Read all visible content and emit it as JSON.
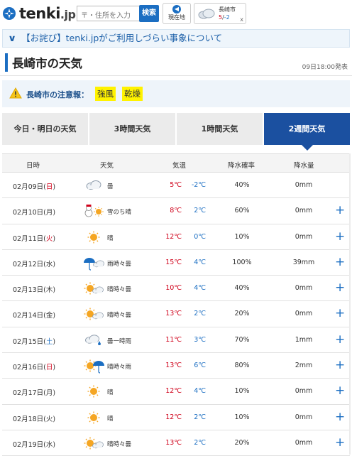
{
  "header": {
    "logo": "tenki",
    "logo_suffix": ".jp",
    "search_placeholder": "〒・住所を入力",
    "search_button": "検索",
    "geo_button": "現在地",
    "fav_city": "長崎市",
    "fav_temp": "5/-2",
    "fav_close": "x"
  },
  "notice": {
    "text": "【お詫び】tenki.jpがご利用しづらい事象について"
  },
  "page": {
    "title": "長崎市の天気",
    "published": "09日18:00発表"
  },
  "warning": {
    "label": "長崎市の注意報：",
    "tags": [
      "強風",
      "乾燥"
    ]
  },
  "tabs": [
    {
      "label": "今日・明日の天気",
      "active": false
    },
    {
      "label": "3時間天気",
      "active": false
    },
    {
      "label": "1時間天気",
      "active": false
    },
    {
      "label": "2週間天気",
      "active": true
    }
  ],
  "table": {
    "headers": [
      "日時",
      "天気",
      "気温",
      "降水確率",
      "降水量"
    ],
    "rows": [
      {
        "date": "02月09日(",
        "dow": "日",
        "dowType": "sun",
        "icon": "cloudy",
        "weather": "曇",
        "hi": "5℃",
        "lo": "-2℃",
        "pop": "40%",
        "amt": "0mm",
        "plus": ""
      },
      {
        "date": "02月10日(",
        "dow": "月",
        "dowType": "",
        "icon": "snow-then-sunny",
        "weather": "雪のち晴",
        "hi": "8℃",
        "lo": "2℃",
        "pop": "60%",
        "amt": "0mm",
        "plus": "+"
      },
      {
        "date": "02月11日(",
        "dow": "火",
        "dowType": "sun",
        "icon": "sunny",
        "weather": "晴",
        "hi": "12℃",
        "lo": "0℃",
        "pop": "10%",
        "amt": "0mm",
        "plus": "+"
      },
      {
        "date": "02月12日(",
        "dow": "水",
        "dowType": "",
        "icon": "rain-sometimes-cloudy",
        "weather": "雨時々曇",
        "hi": "15℃",
        "lo": "4℃",
        "pop": "100%",
        "amt": "39mm",
        "plus": "+"
      },
      {
        "date": "02月13日(",
        "dow": "木",
        "dowType": "",
        "icon": "sunny-sometimes-cloudy",
        "weather": "晴時々曇",
        "hi": "10℃",
        "lo": "4℃",
        "pop": "40%",
        "amt": "0mm",
        "plus": "+"
      },
      {
        "date": "02月14日(",
        "dow": "金",
        "dowType": "",
        "icon": "sunny-sometimes-cloudy",
        "weather": "晴時々曇",
        "hi": "13℃",
        "lo": "2℃",
        "pop": "20%",
        "amt": "0mm",
        "plus": "+"
      },
      {
        "date": "02月15日(",
        "dow": "土",
        "dowType": "sat",
        "icon": "cloudy-briefly-rain",
        "weather": "曇一時雨",
        "hi": "11℃",
        "lo": "3℃",
        "pop": "70%",
        "amt": "1mm",
        "plus": "+"
      },
      {
        "date": "02月16日(",
        "dow": "日",
        "dowType": "sun",
        "icon": "sunny-sometimes-rain",
        "weather": "晴時々雨",
        "hi": "13℃",
        "lo": "6℃",
        "pop": "80%",
        "amt": "2mm",
        "plus": "+"
      },
      {
        "date": "02月17日(",
        "dow": "月",
        "dowType": "",
        "icon": "sunny",
        "weather": "晴",
        "hi": "12℃",
        "lo": "4℃",
        "pop": "10%",
        "amt": "0mm",
        "plus": "+"
      },
      {
        "date": "02月18日(",
        "dow": "火",
        "dowType": "",
        "icon": "sunny",
        "weather": "晴",
        "hi": "12℃",
        "lo": "2℃",
        "pop": "10%",
        "amt": "0mm",
        "plus": "+"
      },
      {
        "date": "02月19日(",
        "dow": "水",
        "dowType": "",
        "icon": "sunny-sometimes-cloudy",
        "weather": "晴時々曇",
        "hi": "13℃",
        "lo": "2℃",
        "pop": "20%",
        "amt": "0mm",
        "plus": "+"
      }
    ]
  },
  "colors": {
    "accent": "#1b6ec2",
    "tab_active": "#1b50a0",
    "hi_temp": "#d0021b",
    "lo_temp": "#1b6ec2",
    "warn_tag": "#fff200"
  }
}
